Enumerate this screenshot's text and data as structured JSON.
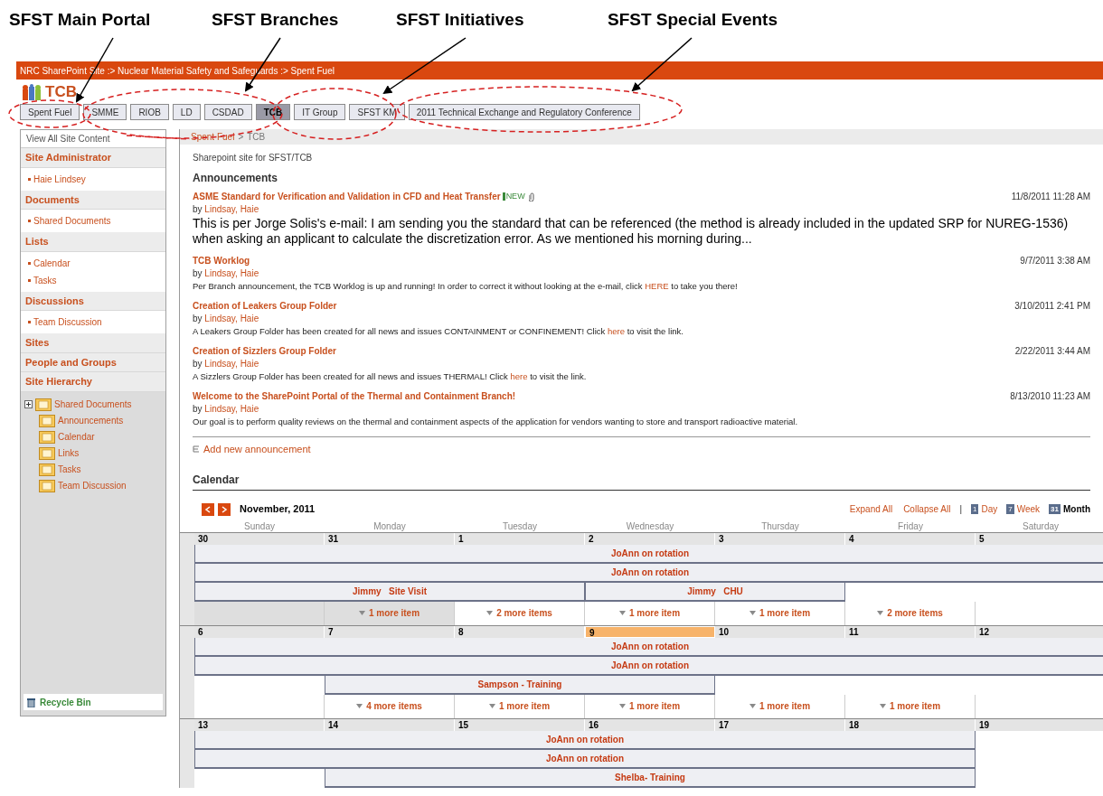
{
  "callouts": [
    {
      "label": "SFST Main Portal"
    },
    {
      "label": "SFST Branches"
    },
    {
      "label": "SFST Initiatives"
    },
    {
      "label": "SFST Special Events"
    }
  ],
  "top_breadcrumb": "NRC SharePoint Site :> Nuclear Material Safety and Safeguards :> Spent Fuel",
  "site_title": "TCB",
  "tabs": [
    {
      "label": "Spent Fuel",
      "selected": false
    },
    {
      "label": "SMME",
      "selected": false
    },
    {
      "label": "RIOB",
      "selected": false
    },
    {
      "label": "LD",
      "selected": false
    },
    {
      "label": "CSDAD",
      "selected": false
    },
    {
      "label": "TCB",
      "selected": true
    },
    {
      "label": "IT Group",
      "selected": false
    },
    {
      "label": "SFST KM",
      "selected": false
    },
    {
      "label": "2011 Technical Exchange and Regulatory Conference",
      "selected": false
    }
  ],
  "sidebar": {
    "view_all": "View All Site Content",
    "sections": [
      {
        "heading": "Site Administrator",
        "items": [
          "Haie Lindsey"
        ]
      },
      {
        "heading": "Documents",
        "items": [
          "Shared Documents"
        ]
      },
      {
        "heading": "Lists",
        "items": [
          "Calendar",
          "Tasks"
        ]
      },
      {
        "heading": "Discussions",
        "items": [
          "Team Discussion"
        ]
      },
      {
        "heading": "Sites"
      },
      {
        "heading": "People and Groups"
      },
      {
        "heading": "Site Hierarchy"
      }
    ],
    "tree": [
      {
        "label": "Shared Documents",
        "expandable": true
      },
      {
        "label": "Announcements",
        "expandable": false
      },
      {
        "label": "Calendar",
        "expandable": false
      },
      {
        "label": "Links",
        "expandable": false
      },
      {
        "label": "Tasks",
        "expandable": false
      },
      {
        "label": "Team Discussion",
        "expandable": false
      }
    ],
    "recycle_bin": "Recycle Bin"
  },
  "breadcrumb": {
    "parent": "Spent Fuel",
    "separator": ">",
    "current": "TCB"
  },
  "description": "Sharepoint site for SFST/TCB",
  "announcements": {
    "title": "Announcements",
    "add_label": "Add new announcement",
    "items": [
      {
        "title": "ASME Standard for Verification and Validation in CFD and Heat Transfer",
        "badge": "NEW",
        "attachment": true,
        "by": "by",
        "author": "Lindsay, Haie",
        "date": "11/8/2011 11:28 AM",
        "large": true,
        "body": [
          {
            "kind": "text",
            "text": "This is per Jorge Solis's e-mail: I am sending you the standard that can be referenced (the method is already included in the updated SRP for NUREG-1536) when asking an applicant to calculate the discretization error.  As we mentioned his morning during..."
          }
        ]
      },
      {
        "title": "TCB Worklog",
        "attachment": false,
        "by": "by",
        "author": "Lindsay, Haie",
        "date": "9/7/2011 3:38 AM",
        "large": false,
        "body": [
          {
            "kind": "text",
            "text": "Per Branch announcement, the TCB Worklog is up and running! In order to correct it without looking at the e-mail, click "
          },
          {
            "kind": "link",
            "text": "HERE"
          },
          {
            "kind": "text",
            "text": " to take you there!"
          }
        ]
      },
      {
        "title": "Creation of Leakers Group Folder",
        "attachment": false,
        "by": "by",
        "author": "Lindsay, Haie",
        "date": "3/10/2011 2:41 PM",
        "large": false,
        "body": [
          {
            "kind": "text",
            "text": "A Leakers Group Folder has been created for all news and issues CONTAINMENT or CONFINEMENT! Click "
          },
          {
            "kind": "link",
            "text": "here"
          },
          {
            "kind": "text",
            "text": " to visit the link."
          }
        ]
      },
      {
        "title": "Creation of Sizzlers Group Folder",
        "attachment": false,
        "by": "by",
        "author": "Lindsay, Haie",
        "date": "2/22/2011 3:44 AM",
        "large": false,
        "body": [
          {
            "kind": "text",
            "text": "A Sizzlers Group Folder has been created for all news and issues THERMAL! Click "
          },
          {
            "kind": "link",
            "text": "here"
          },
          {
            "kind": "text",
            "text": " to visit the link."
          }
        ]
      },
      {
        "title": "Welcome to the SharePoint Portal of the Thermal and Containment Branch!",
        "attachment": false,
        "by": "by",
        "author": "Lindsay, Haie",
        "date": "8/13/2010 11:23 AM",
        "large": false,
        "body": [
          {
            "kind": "text",
            "text": "Our goal is to perform quality reviews on the thermal and containment aspects of the application for vendors wanting to store and transport radioactive material."
          }
        ]
      }
    ]
  },
  "calendar": {
    "title": "Calendar",
    "month": "November, 2011",
    "expand_all": "Expand All",
    "collapse_all": "Collapse All",
    "divider": "|",
    "views": [
      {
        "label": "Day",
        "icon_text": "1",
        "selected": false
      },
      {
        "label": "Week",
        "icon_text": "7",
        "selected": false
      },
      {
        "label": "Month",
        "icon_text": "31",
        "selected": true
      }
    ],
    "weekdays": [
      "Sunday",
      "Monday",
      "Tuesday",
      "Wednesday",
      "Thursday",
      "Friday",
      "Saturday"
    ],
    "weeks": [
      {
        "days": [
          {
            "number": "30",
            "today": false
          },
          {
            "number": "31",
            "today": false
          },
          {
            "number": "1",
            "today": false
          },
          {
            "number": "2",
            "today": false
          },
          {
            "number": "3",
            "today": false
          },
          {
            "number": "4",
            "today": false
          },
          {
            "number": "5",
            "today": false
          }
        ],
        "rows": [
          {
            "slots": [
              {
                "kind": "start",
                "title": "JoAnn on rotation"
              },
              {
                "kind": "continued"
              },
              {
                "kind": "continued"
              },
              {
                "kind": "continued"
              },
              {
                "kind": "continued"
              },
              {
                "kind": "continued"
              },
              {
                "kind": "continued"
              }
            ]
          },
          {
            "slots": [
              {
                "kind": "start",
                "title": "JoAnn on rotation"
              },
              {
                "kind": "continued"
              },
              {
                "kind": "continued"
              },
              {
                "kind": "continued"
              },
              {
                "kind": "continued"
              },
              {
                "kind": "continued"
              },
              {
                "kind": "continued"
              }
            ]
          },
          {
            "slots": [
              {
                "kind": "start",
                "title": "Jimmy   Site Visit"
              },
              {
                "kind": "continued"
              },
              {
                "kind": "continued"
              },
              {
                "kind": "start",
                "title": "Jimmy   CHU"
              },
              {
                "kind": "continued"
              },
              {
                "kind": "empty"
              },
              {
                "kind": "empty"
              }
            ]
          }
        ],
        "more": [
          {
            "shaded": true
          },
          {
            "text": "1 more item",
            "shaded": true
          },
          {
            "text": "2 more items",
            "shaded": false
          },
          {
            "text": "1 more item",
            "shaded": false
          },
          {
            "text": "1 more item",
            "shaded": false
          },
          {
            "text": "2 more items",
            "shaded": false
          },
          {
            "shaded": false
          }
        ]
      },
      {
        "days": [
          {
            "number": "6",
            "today": false
          },
          {
            "number": "7",
            "today": false
          },
          {
            "number": "8",
            "today": false
          },
          {
            "number": "9",
            "today": true
          },
          {
            "number": "10",
            "today": false
          },
          {
            "number": "11",
            "today": false
          },
          {
            "number": "12",
            "today": false
          }
        ],
        "rows": [
          {
            "slots": [
              {
                "kind": "start",
                "title": "JoAnn on rotation"
              },
              {
                "kind": "continued"
              },
              {
                "kind": "continued"
              },
              {
                "kind": "continued"
              },
              {
                "kind": "continued"
              },
              {
                "kind": "continued"
              },
              {
                "kind": "continued"
              }
            ]
          },
          {
            "slots": [
              {
                "kind": "start",
                "title": "JoAnn on rotation"
              },
              {
                "kind": "continued"
              },
              {
                "kind": "continued"
              },
              {
                "kind": "continued"
              },
              {
                "kind": "continued"
              },
              {
                "kind": "continued"
              },
              {
                "kind": "continued"
              }
            ]
          },
          {
            "slots": [
              {
                "kind": "empty"
              },
              {
                "kind": "start",
                "title": "Sampson - Training"
              },
              {
                "kind": "continued"
              },
              {
                "kind": "continued"
              },
              {
                "kind": "empty"
              },
              {
                "kind": "empty"
              },
              {
                "kind": "empty"
              }
            ]
          }
        ],
        "more": [
          {
            "shaded": false
          },
          {
            "text": "4 more items",
            "shaded": false
          },
          {
            "text": "1 more item",
            "shaded": false
          },
          {
            "text": "1 more item",
            "shaded": false
          },
          {
            "text": "1 more item",
            "shaded": false
          },
          {
            "text": "1 more item",
            "shaded": false
          },
          {
            "shaded": false
          }
        ]
      },
      {
        "days": [
          {
            "number": "13",
            "today": false
          },
          {
            "number": "14",
            "today": false
          },
          {
            "number": "15",
            "today": false
          },
          {
            "number": "16",
            "today": false
          },
          {
            "number": "17",
            "today": false
          },
          {
            "number": "18",
            "today": false
          },
          {
            "number": "19",
            "today": false
          }
        ],
        "rows": [
          {
            "slots": [
              {
                "kind": "start",
                "title": "JoAnn on rotation"
              },
              {
                "kind": "continued"
              },
              {
                "kind": "continued"
              },
              {
                "kind": "continued"
              },
              {
                "kind": "continued"
              },
              {
                "kind": "continued"
              },
              {
                "kind": "empty"
              }
            ]
          },
          {
            "slots": [
              {
                "kind": "start",
                "title": "JoAnn on rotation"
              },
              {
                "kind": "continued"
              },
              {
                "kind": "continued"
              },
              {
                "kind": "continued"
              },
              {
                "kind": "continued"
              },
              {
                "kind": "continued"
              },
              {
                "kind": "empty"
              }
            ]
          },
          {
            "slots": [
              {
                "kind": "empty"
              },
              {
                "kind": "start",
                "title": "Shelba- Training"
              },
              {
                "kind": "continued"
              },
              {
                "kind": "continued"
              },
              {
                "kind": "continued"
              },
              {
                "kind": "continued"
              },
              {
                "kind": "empty"
              }
            ]
          }
        ]
      }
    ]
  }
}
